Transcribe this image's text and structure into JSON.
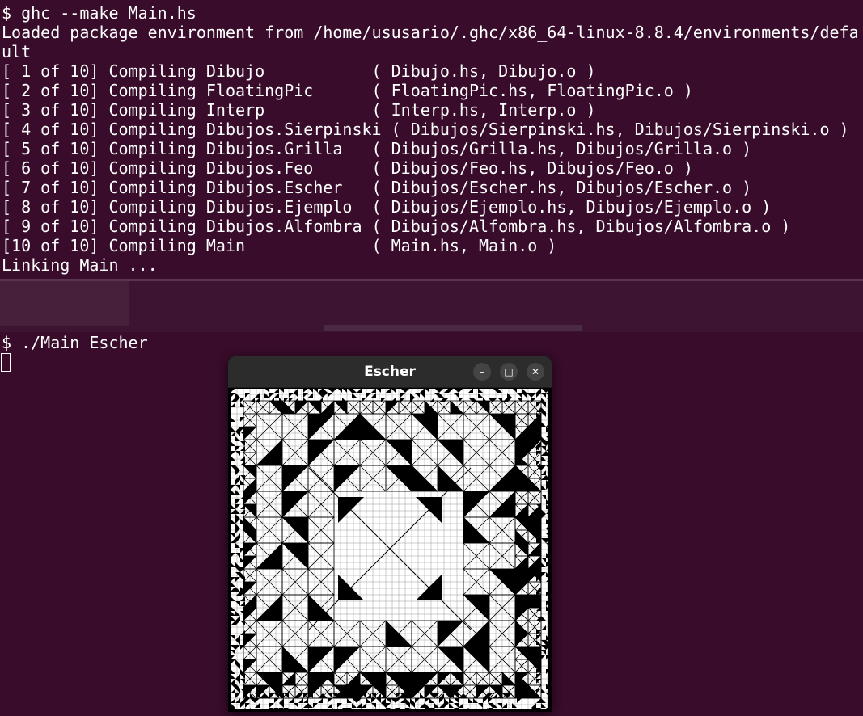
{
  "terminal": {
    "lines": [
      "$ ghc --make Main.hs",
      "Loaded package environment from /home/ususario/.ghc/x86_64-linux-8.8.4/environments/defa",
      "ult",
      "[ 1 of 10] Compiling Dibujo           ( Dibujo.hs, Dibujo.o )",
      "[ 2 of 10] Compiling FloatingPic      ( FloatingPic.hs, FloatingPic.o )",
      "[ 3 of 10] Compiling Interp           ( Interp.hs, Interp.o )",
      "[ 4 of 10] Compiling Dibujos.Sierpinski ( Dibujos/Sierpinski.hs, Dibujos/Sierpinski.o )",
      "[ 5 of 10] Compiling Dibujos.Grilla   ( Dibujos/Grilla.hs, Dibujos/Grilla.o )",
      "[ 6 of 10] Compiling Dibujos.Feo      ( Dibujos/Feo.hs, Dibujos/Feo.o )",
      "[ 7 of 10] Compiling Dibujos.Escher   ( Dibujos/Escher.hs, Dibujos/Escher.o )",
      "[ 8 of 10] Compiling Dibujos.Ejemplo  ( Dibujos/Ejemplo.hs, Dibujos/Ejemplo.o )",
      "[ 9 of 10] Compiling Dibujos.Alfombra ( Dibujos/Alfombra.hs, Dibujos/Alfombra.o )",
      "[10 of 10] Compiling Main             ( Main.hs, Main.o )",
      "Linking Main ..."
    ],
    "command_line": "$ ./Main Escher"
  },
  "window": {
    "title": "Escher",
    "minimize_glyph": "–",
    "maximize_glyph": "□",
    "close_glyph": "✕"
  },
  "colors": {
    "terminal_bg": "#380c2a",
    "terminal_fg": "#ffffff",
    "titlebar_bg": "#2c2c2c"
  }
}
